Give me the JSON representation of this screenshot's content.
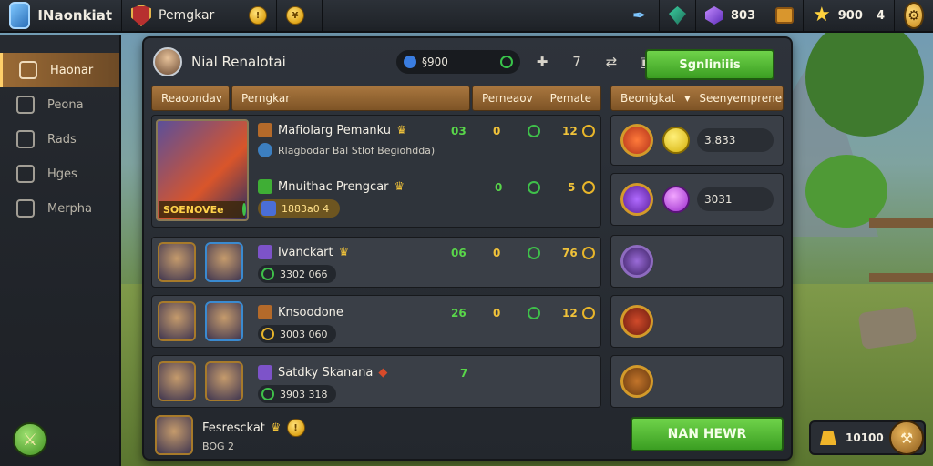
{
  "topbar": {
    "brand": "INaonkiat",
    "section_label": "Pemgkar",
    "gem_value": "803",
    "star_value": "900",
    "star_extra": "4"
  },
  "sidebar": {
    "items": [
      {
        "label": "Haonar",
        "icon": "home-icon"
      },
      {
        "label": "Peona",
        "icon": "pencil-icon"
      },
      {
        "label": "Rads",
        "icon": "scroll-icon"
      },
      {
        "label": "Hges",
        "icon": "card-icon"
      },
      {
        "label": "Merpha",
        "icon": "arrow-icon"
      }
    ]
  },
  "header": {
    "player_name": "Nial Renalotai",
    "search_value": "§900",
    "count": "7",
    "action_label": "Sgnliniiis"
  },
  "columns": {
    "col1": "Reaoondav",
    "col2": "Perngkar",
    "col3": "Perneaov",
    "col4": "Pemate",
    "col5": "Beonigkat",
    "col6": "Seenyemprene"
  },
  "rows": [
    {
      "title": "Mafiolarg Pemanku",
      "subtitle": "Rlagbodar Bal Stlof Begiohdda)",
      "stat1": "03",
      "stat2": "0",
      "stat3": "12",
      "badge": "SOENOVEe",
      "second_title": "Mnuithac Prengcar",
      "second_stat1": "0",
      "second_stat2": "5",
      "second_value": "1883a0 4"
    },
    {
      "title": "Ivanckart",
      "stat1": "06",
      "stat2": "0",
      "stat3": "76",
      "value": "3302 066"
    },
    {
      "title": "Knsoodone",
      "stat1": "26",
      "stat2": "0",
      "stat3": "12",
      "value": "3003 060"
    },
    {
      "title": "Satdky Skanana",
      "stat1": "7",
      "value": "3903 318"
    }
  ],
  "right_items": [
    {
      "value": "3.833"
    },
    {
      "value": "3031"
    }
  ],
  "footer": {
    "name": "Fesresckat",
    "sub": "BOG 2",
    "button": "NAN HEWR"
  },
  "corner": {
    "value": "10100"
  },
  "colors": {
    "accent_green": "#4caf2f",
    "accent_gold": "#e0a61a",
    "tab_brown": "#9a6a35"
  }
}
